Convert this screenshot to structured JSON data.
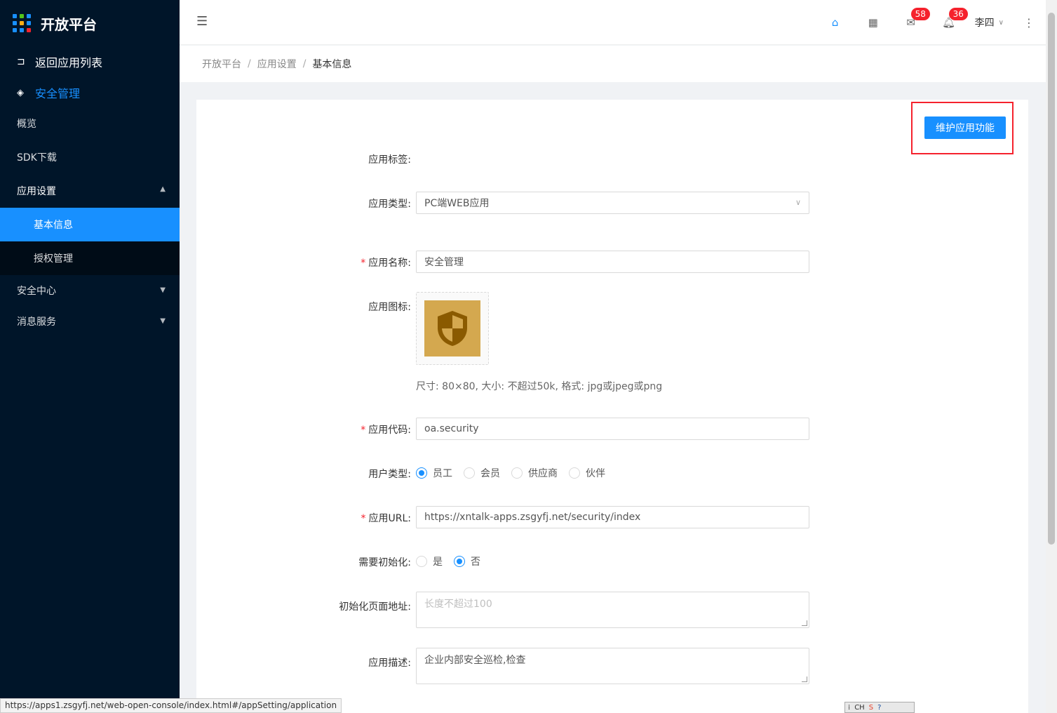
{
  "app": {
    "title": "开放平台"
  },
  "sidebar": {
    "back_label": "返回应用列表",
    "current_app": "安全管理",
    "menu": [
      {
        "label": "概览"
      },
      {
        "label": "SDK下载"
      },
      {
        "label": "应用设置",
        "open": true,
        "children": [
          {
            "label": "基本信息",
            "active": true
          },
          {
            "label": "授权管理"
          }
        ]
      },
      {
        "label": "安全中心"
      },
      {
        "label": "消息服务"
      }
    ]
  },
  "header": {
    "mail_count": "58",
    "notice_count": "36",
    "user_name": "李四"
  },
  "breadcrumb": [
    "开放平台",
    "应用设置",
    "基本信息"
  ],
  "form": {
    "maintain_button": "维护应用功能",
    "tag_label": "应用标签:",
    "type_label": "应用类型:",
    "type_value": "PC端WEB应用",
    "name_label": "应用名称:",
    "name_value": "安全管理",
    "icon_label": "应用图标:",
    "icon_hint": "尺寸: 80×80, 大小: 不超过50k, 格式: jpg或jpeg或png",
    "code_label": "应用代码:",
    "code_value": "oa.security",
    "user_type_label": "用户类型:",
    "user_types": [
      "员工",
      "会员",
      "供应商",
      "伙伴"
    ],
    "user_type_selected": "员工",
    "url_label": "应用URL:",
    "url_value": "https://xntalk-apps.zsgyfj.net/security/index",
    "init_label": "需要初始化:",
    "init_options": [
      "是",
      "否"
    ],
    "init_selected": "否",
    "init_page_label": "初始化页面地址:",
    "init_page_placeholder": "长度不超过100",
    "desc_label": "应用描述:",
    "desc_value": "企业内部安全巡检,检查"
  },
  "status_bar": {
    "url": "https://apps1.zsgyfj.net/web-open-console/index.html#/appSetting/application"
  },
  "ime": {
    "label": "CH"
  },
  "colors": {
    "primary": "#1890ff",
    "sidebar": "#001529",
    "badge": "#f5222d",
    "icon_bg": "#d4a84f"
  }
}
